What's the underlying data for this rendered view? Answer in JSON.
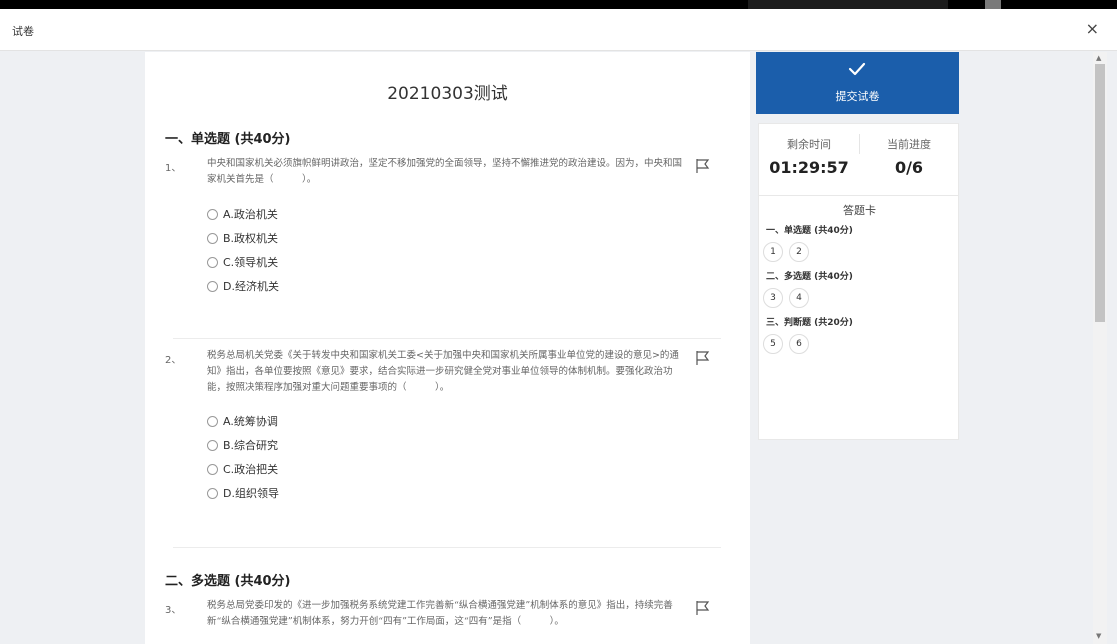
{
  "window": {
    "title": "试卷",
    "close_label": "×"
  },
  "exam": {
    "title": "20210303测试"
  },
  "sections": [
    {
      "title": "一、单选题 (共40分)"
    },
    {
      "title": "二、多选题 (共40分)"
    }
  ],
  "questions": [
    {
      "number": "1、",
      "text": "中央和国家机关必须旗帜鲜明讲政治，坚定不移加强党的全面领导，坚持不懈推进党的政治建设。因为，中央和国家机关首先是（　　　）。",
      "options": [
        "A.政治机关",
        "B.政权机关",
        "C.领导机关",
        "D.经济机关"
      ]
    },
    {
      "number": "2、",
      "text": "税务总局机关党委《关于转发中央和国家机关工委<关于加强中央和国家机关所属事业单位党的建设的意见>的通知》指出，各单位要按照《意见》要求，结合实际进一步研究健全党对事业单位领导的体制机制。要强化政治功能，按照决策程序加强对重大问题重要事项的（　　　）。",
      "options": [
        "A.统筹协调",
        "B.综合研究",
        "C.政治把关",
        "D.组织领导"
      ]
    },
    {
      "number": "3、",
      "text": "税务总局党委印发的《进一步加强税务系统党建工作完善新“纵合横通强党建”机制体系的意见》指出，持续完善新“纵合横通强党建”机制体系，努力开创“四有”工作局面，这“四有”是指（　　　）。"
    }
  ],
  "sidebar": {
    "submit_label": "提交试卷",
    "remaining_label": "剩余时间",
    "remaining_value": "01:29:57",
    "progress_label": "当前进度",
    "progress_value": "0/6",
    "card_title": "答题卡",
    "card_sections": [
      {
        "title": "一、单选题 (共40分)",
        "items": [
          "1",
          "2"
        ]
      },
      {
        "title": "二、多选题 (共40分)",
        "items": [
          "3",
          "4"
        ]
      },
      {
        "title": "三、判断题 (共20分)",
        "items": [
          "5",
          "6"
        ]
      }
    ]
  },
  "scrollbar": {
    "up_arrow": "▲",
    "down_arrow": "▼"
  },
  "colors": {
    "accent": "#1b5eab",
    "background": "#eef0f3",
    "paper": "#ffffff"
  },
  "icons": {
    "submit": "check-icon",
    "flag": "flag-icon",
    "close": "close-icon"
  }
}
